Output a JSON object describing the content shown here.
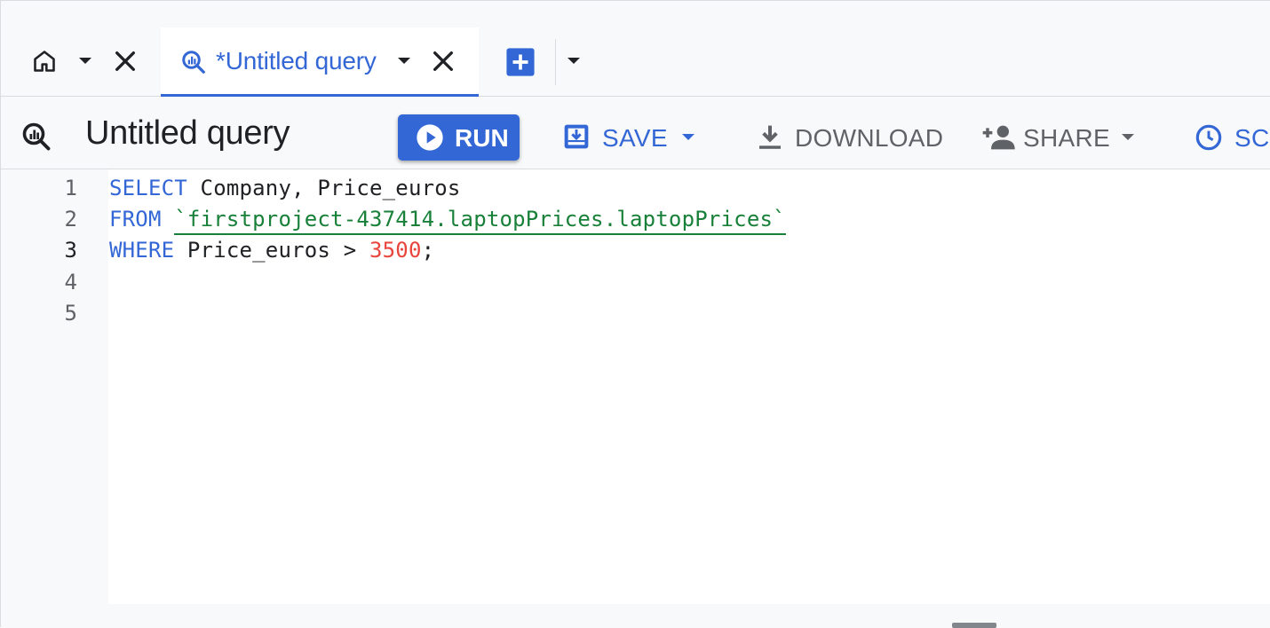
{
  "tabs": {
    "home_tab": {
      "icon": "home-icon",
      "dropdown_icon": "caret-down-icon",
      "close_icon": "close-icon"
    },
    "query_tab": {
      "title": "*Untitled query",
      "icon": "query-icon",
      "dropdown_icon": "caret-down-icon",
      "close_icon": "close-icon"
    },
    "new_tab_icon": "add-box-icon",
    "more_tabs_icon": "caret-down-icon"
  },
  "toolbar": {
    "query_icon": "query-icon",
    "title": "Untitled query",
    "run_label": "RUN",
    "save_label": "SAVE",
    "download_label": "DOWNLOAD",
    "share_label": "SHARE",
    "schedule_label": "SCHEDULE"
  },
  "editor": {
    "line_numbers": [
      "1",
      "2",
      "3",
      "4",
      "5"
    ],
    "active_line": "3",
    "lines": [
      {
        "kw": "SELECT",
        "rest": " Company, Price_euros"
      },
      {
        "kw": "FROM",
        "sp": " ",
        "table": "`firstproject-437414.laptopPrices.laptopPrices`"
      },
      {
        "kw": "WHERE",
        "rest": " Price_euros > ",
        "num": "3500",
        "end": ";"
      }
    ]
  },
  "colors": {
    "accent": "#3367d6",
    "keyword": "#3367d6",
    "table_ref": "#188038",
    "number": "#e8453c",
    "toolbar_text": "#5f6368"
  }
}
